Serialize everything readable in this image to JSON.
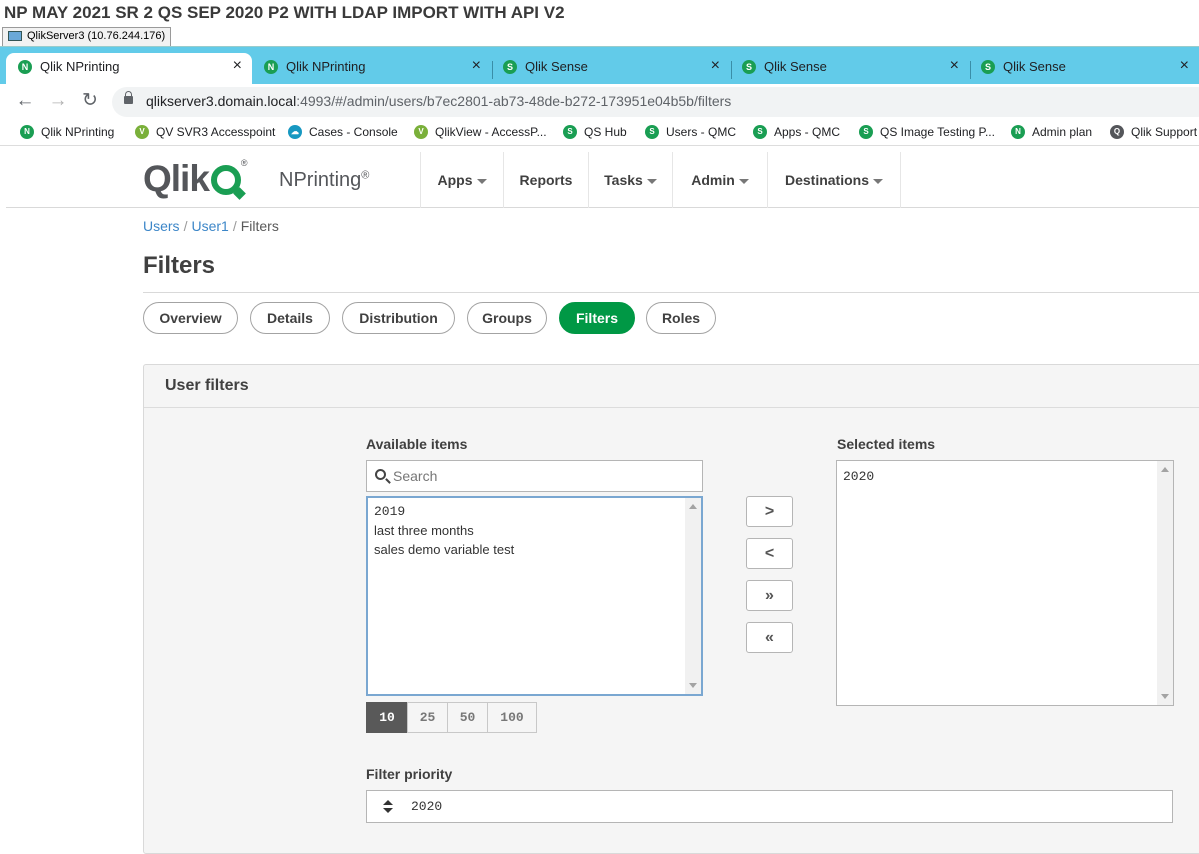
{
  "window": {
    "banner_title": "NP MAY 2021 SR 2 QS SEP 2020 P2 WITH LDAP IMPORT WITH API V2",
    "rdp_title": "QlikServer3 (10.76.244.176)"
  },
  "browser": {
    "tabs": [
      {
        "label": "Qlik NPrinting",
        "icon": "qlik-nprinting-icon",
        "active": true
      },
      {
        "label": "Qlik NPrinting",
        "icon": "qlik-nprinting-icon",
        "active": false
      },
      {
        "label": "Qlik Sense",
        "icon": "qlik-sense-icon",
        "active": false
      },
      {
        "label": "Qlik Sense",
        "icon": "qlik-sense-icon",
        "active": false
      },
      {
        "label": "Qlik Sense",
        "icon": "qlik-sense-icon",
        "active": false
      }
    ],
    "close_glyph": "×",
    "url_host": "qlikserver3.domain.local",
    "url_path": ":4993/#/admin/users/b7ec2801-ab73-48de-b272-173951e04b5b/filters",
    "bookmarks": [
      {
        "label": "Qlik NPrinting",
        "icon": "N",
        "color": "#1a9e53"
      },
      {
        "label": "QV SVR3 Accesspoint",
        "icon": "V",
        "color": "#7ab03a"
      },
      {
        "label": "Cases - Console",
        "icon": "☁",
        "color": "#1798c1"
      },
      {
        "label": "QlikView - AccessP...",
        "icon": "V",
        "color": "#7ab03a"
      },
      {
        "label": "QS Hub",
        "icon": "S",
        "color": "#1a9e53"
      },
      {
        "label": "Users - QMC",
        "icon": "S",
        "color": "#1a9e53"
      },
      {
        "label": "Apps - QMC",
        "icon": "S",
        "color": "#1a9e53"
      },
      {
        "label": "QS Image Testing P...",
        "icon": "S",
        "color": "#1a9e53"
      },
      {
        "label": "Admin plan",
        "icon": "N",
        "color": "#1a9e53"
      },
      {
        "label": "Qlik Support",
        "icon": "Q",
        "color": "#54565a"
      }
    ]
  },
  "app": {
    "logo_text": "Qlik",
    "logo_reg": "®",
    "product": "NPrinting",
    "product_reg": "®",
    "menu": [
      {
        "label": "Apps",
        "dropdown": true
      },
      {
        "label": "Reports",
        "dropdown": false
      },
      {
        "label": "Tasks",
        "dropdown": true
      },
      {
        "label": "Admin",
        "dropdown": true
      },
      {
        "label": "Destinations",
        "dropdown": true
      }
    ],
    "accent": "#009845"
  },
  "breadcrumb": {
    "items": [
      "Users",
      "User1"
    ],
    "current": "Filters",
    "separator": "/"
  },
  "page_title": "Filters",
  "subtabs": [
    {
      "label": "Overview",
      "active": false
    },
    {
      "label": "Details",
      "active": false
    },
    {
      "label": "Distribution",
      "active": false
    },
    {
      "label": "Groups",
      "active": false
    },
    {
      "label": "Filters",
      "active": true
    },
    {
      "label": "Roles",
      "active": false
    }
  ],
  "panel": {
    "title": "User filters",
    "available_label": "Available items",
    "search_placeholder": "Search",
    "available_items": [
      "2019",
      "last three months",
      "sales demo variable test"
    ],
    "selected_label": "Selected items",
    "selected_items": [
      "2020"
    ],
    "move_buttons": [
      ">",
      "<",
      "»",
      "«"
    ],
    "page_sizes": [
      "10",
      "25",
      "50",
      "100"
    ],
    "page_size_selected": "10",
    "priority_label": "Filter priority",
    "priority_value": "2020"
  }
}
